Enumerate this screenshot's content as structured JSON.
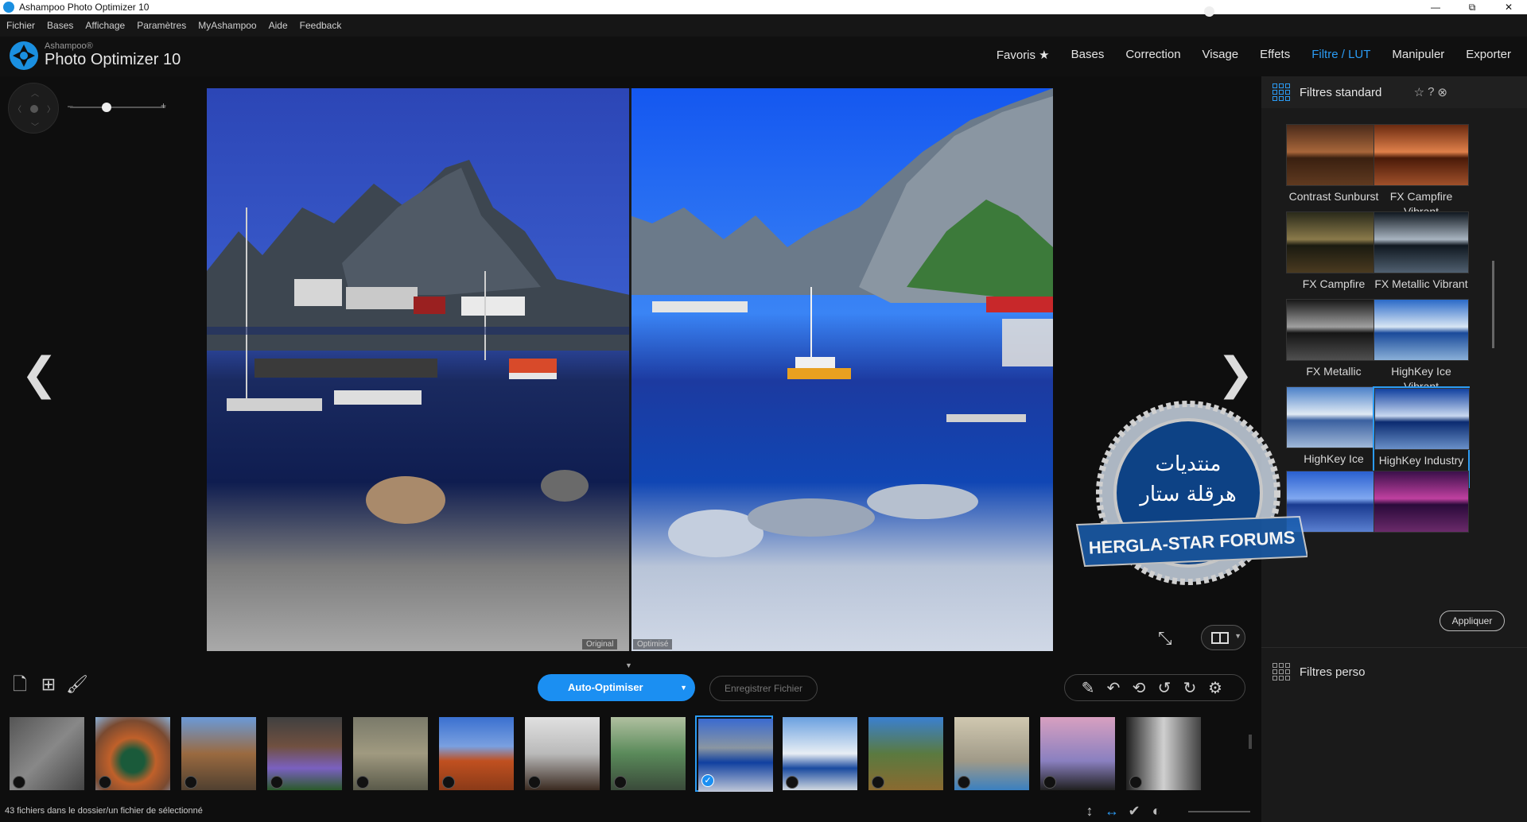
{
  "window": {
    "title": "Ashampoo Photo Optimizer 10",
    "controls": [
      "—",
      "⧉",
      "✕"
    ]
  },
  "menu": [
    "Fichier",
    "Bases",
    "Affichage",
    "Paramètres",
    "MyAshampoo",
    "Aide",
    "Feedback"
  ],
  "brand": {
    "small": "Ashampoo®",
    "name": "Photo Optimizer 10"
  },
  "nav": [
    {
      "label": "Favoris ★",
      "active": false
    },
    {
      "label": "Bases",
      "active": false
    },
    {
      "label": "Correction",
      "active": false
    },
    {
      "label": "Visage",
      "active": false
    },
    {
      "label": "Effets",
      "active": false
    },
    {
      "label": "Filtre / LUT",
      "active": true
    },
    {
      "label": "Manipuler",
      "active": false
    },
    {
      "label": "Exporter",
      "active": false
    }
  ],
  "zoom": {
    "minus": "–",
    "plus": "+",
    "level": 0.33
  },
  "viewer": {
    "original_label": "Original",
    "optimized_label": "Optimisé",
    "prev": "❮",
    "next": "❯"
  },
  "panel": {
    "title": "Filtres standard",
    "tools": [
      "☆",
      "?",
      "⊗"
    ],
    "filters": [
      {
        "label": "Contrast Sunburst",
        "tone": "sunburst"
      },
      {
        "label": "FX Campfire Vibrant",
        "tone": "campfire-vibrant"
      },
      {
        "label": "FX Campfire",
        "tone": "campfire"
      },
      {
        "label": "FX Metallic Vibrant",
        "tone": "metallic-vibrant"
      },
      {
        "label": "FX Metallic",
        "tone": "metallic"
      },
      {
        "label": "HighKey Ice Vibrant",
        "tone": "ice-vibrant"
      },
      {
        "label": "HighKey Ice",
        "tone": "ice"
      },
      {
        "label": "HighKey Industry Vibrant",
        "tone": "industry-vibrant",
        "selected": true
      },
      {
        "label": "",
        "tone": "blue"
      },
      {
        "label": "",
        "tone": "purple"
      }
    ],
    "apply_label": "Appliquer",
    "perso_title": "Filtres perso"
  },
  "watermark": {
    "arabic_line1": "منتديات",
    "arabic_line2": "هرقلة ستار",
    "ribbon": "HERGLA-STAR FORUMS"
  },
  "toolbar": {
    "auto_label": "Auto-Optimiser",
    "save_label": "Enregistrer Fichier",
    "left_icons": [
      "new-file-icon",
      "add-files-icon",
      "brush-icon"
    ],
    "right_icons": [
      "magic-wand-icon",
      "undo-icon",
      "undo-all-icon",
      "rotate-left-icon",
      "rotate-right-icon",
      "settings-icon"
    ]
  },
  "filmstrip": [
    {
      "subject": "route-66",
      "selected": false
    },
    {
      "subject": "horseshoe-bend",
      "selected": false
    },
    {
      "subject": "mailboxes",
      "selected": false
    },
    {
      "subject": "flowers",
      "selected": false
    },
    {
      "subject": "monkeys",
      "selected": false
    },
    {
      "subject": "monument-valley",
      "selected": false
    },
    {
      "subject": "horse-street",
      "selected": false
    },
    {
      "subject": "lake-bench",
      "selected": false
    },
    {
      "subject": "fjord-harbor",
      "selected": true
    },
    {
      "subject": "santorini",
      "selected": false
    },
    {
      "subject": "old-truck",
      "selected": false
    },
    {
      "subject": "havana-building",
      "selected": false
    },
    {
      "subject": "palm-sunset",
      "selected": false
    },
    {
      "subject": "bw-stairs",
      "selected": false
    }
  ],
  "status": {
    "text": "43 fichiers dans le dossier/un fichier de sélectionné",
    "icons": [
      "fit-height-icon",
      "fit-width-icon",
      "check-icon",
      "compare-icon"
    ],
    "zoom_level": 0.3
  },
  "colors": {
    "accent": "#2b9bf4",
    "button": "#1b8ff2",
    "background": "#0e0e0e"
  }
}
